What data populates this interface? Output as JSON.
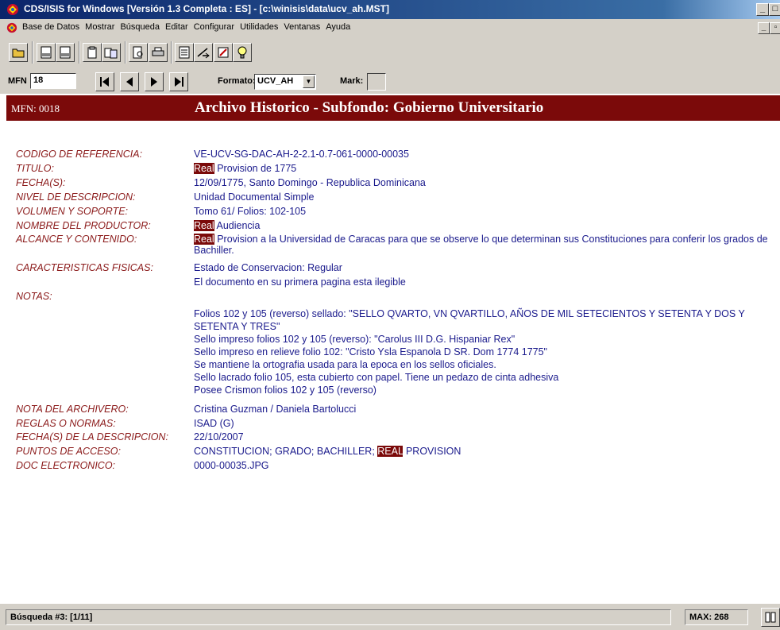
{
  "window": {
    "title": "CDS/ISIS for Windows [Versión 1.3 Completa : ES] - [c:\\winisis\\data\\ucv_ah.MST]"
  },
  "menu": [
    "Base de Datos",
    "Mostrar",
    "Búsqueda",
    "Editar",
    "Configurar",
    "Utilidades",
    "Ventanas",
    "Ayuda"
  ],
  "nav": {
    "mfn_label": "MFN",
    "mfn_value": "18",
    "format_label": "Formato:",
    "format_value": "UCV_AH",
    "mark_label": "Mark:"
  },
  "record": {
    "mfn": "MFN: 0018",
    "header_title": "Archivo Historico - Subfondo: Gobierno Universitario",
    "labels": {
      "codigo": "CODIGO DE REFERENCIA:",
      "titulo": "TITULO:",
      "fechas": "FECHA(S):",
      "nivel": "NIVEL DE DESCRIPCION:",
      "volumen": "VOLUMEN Y SOPORTE:",
      "productor": "NOMBRE DEL PRODUCTOR:",
      "alcance": "ALCANCE Y CONTENIDO:",
      "caract": "CARACTERISTICAS FISICAS:",
      "notas": "NOTAS:",
      "nota_arch": "NOTA DEL ARCHIVERO:",
      "reglas": "REGLAS O NORMAS:",
      "fecha_desc": "FECHA(S) DE LA DESCRIPCION:",
      "puntos": "PUNTOS DE ACCESO:",
      "doc": "DOC ELECTRONICO:"
    },
    "codigo": "VE-UCV-SG-DAC-AH-2-2.1-0.7-061-0000-00035",
    "titulo_hl": "Real",
    "titulo_rest": " Provision de 1775",
    "fechas": "12/09/1775, Santo Domingo - Republica Dominicana",
    "nivel": "Unidad Documental Simple",
    "volumen": "Tomo 61/ Folios: 102-105",
    "productor_hl": "Real",
    "productor_rest": " Audiencia",
    "alcance_hl": "Real",
    "alcance_rest": " Provision a la Universidad de Caracas para que se observe lo que determinan sus Constituciones para conferir los grados de Bachiller.",
    "caract_1": "Estado de Conservacion: Regular",
    "caract_2": "El documento en su primera pagina esta ilegible",
    "notas_1": "Folios 102 y 105 (reverso) sellado: \"SELLO QVARTO, VN QVARTILLO, AÑOS DE MIL SETECIENTOS Y SETENTA Y DOS Y SETENTA Y TRES\"",
    "notas_2": "Sello impreso folios 102 y 105 (reverso): \"Carolus III D.G. Hispaniar Rex\"",
    "notas_3": "Sello impreso en relieve folio 102: \"Cristo Ysla Espanola D SR. Dom 1774 1775\"",
    "notas_4": "Se mantiene la ortografia usada para la epoca en los sellos oficiales.",
    "notas_5": "Sello lacrado folio 105, esta cubierto con papel. Tiene un pedazo de cinta adhesiva",
    "notas_6": "Posee Crismon folios 102 y 105 (reverso)",
    "nota_arch": "Cristina Guzman / Daniela Bartolucci",
    "reglas": "ISAD (G)",
    "fecha_desc": "22/10/2007",
    "puntos_pre": "CONSTITUCION; GRADO; BACHILLER; ",
    "puntos_hl": "REAL",
    "puntos_rest": " PROVISION",
    "doc": "0000-00035.JPG"
  },
  "status": {
    "search": "Búsqueda #3: [1/11]",
    "max": "MAX: 268"
  }
}
